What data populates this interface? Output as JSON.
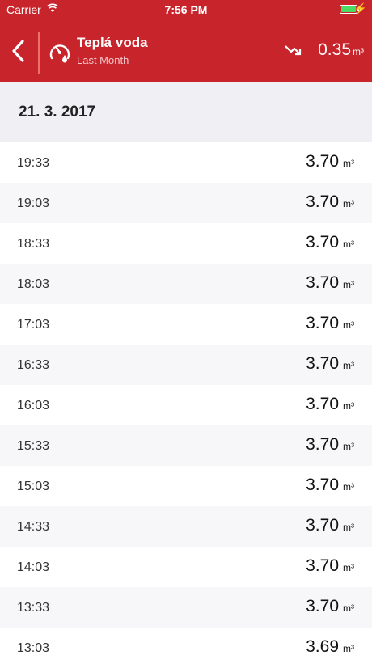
{
  "status_bar": {
    "carrier": "Carrier",
    "time": "7:56 PM"
  },
  "header": {
    "title": "Teplá voda",
    "subtitle": "Last Month",
    "total_value": "0.35",
    "total_unit": "m³",
    "accent_color": "#c8242b"
  },
  "section": {
    "date": "21. 3. 2017"
  },
  "readings": [
    {
      "time": "19:33",
      "value": "3.70",
      "unit": "m³"
    },
    {
      "time": "19:03",
      "value": "3.70",
      "unit": "m³"
    },
    {
      "time": "18:33",
      "value": "3.70",
      "unit": "m³"
    },
    {
      "time": "18:03",
      "value": "3.70",
      "unit": "m³"
    },
    {
      "time": "17:03",
      "value": "3.70",
      "unit": "m³"
    },
    {
      "time": "16:33",
      "value": "3.70",
      "unit": "m³"
    },
    {
      "time": "16:03",
      "value": "3.70",
      "unit": "m³"
    },
    {
      "time": "15:33",
      "value": "3.70",
      "unit": "m³"
    },
    {
      "time": "15:03",
      "value": "3.70",
      "unit": "m³"
    },
    {
      "time": "14:33",
      "value": "3.70",
      "unit": "m³"
    },
    {
      "time": "14:03",
      "value": "3.70",
      "unit": "m³"
    },
    {
      "time": "13:33",
      "value": "3.70",
      "unit": "m³"
    },
    {
      "time": "13:03",
      "value": "3.69",
      "unit": "m³"
    }
  ]
}
